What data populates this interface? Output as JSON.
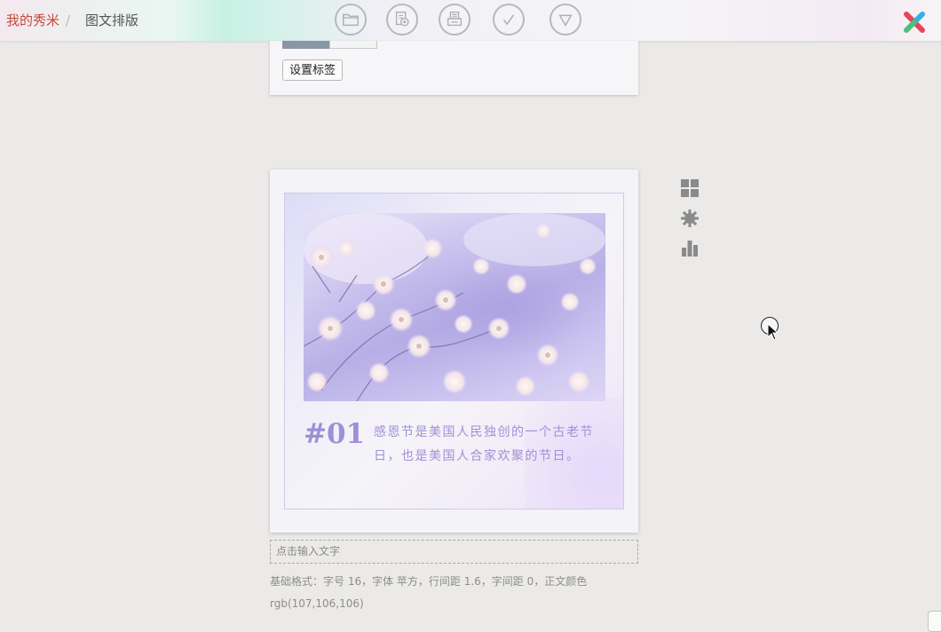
{
  "breadcrumb": {
    "home": "我的秀米",
    "separator": "/",
    "current": "图文排版"
  },
  "toolbar": {
    "buttons": [
      {
        "name": "folder-button",
        "icon": "folder-icon"
      },
      {
        "name": "preview-button",
        "icon": "preview-icon"
      },
      {
        "name": "print-button",
        "icon": "print-icon"
      },
      {
        "name": "check-button",
        "icon": "check-icon"
      },
      {
        "name": "dropdown-button",
        "icon": "triangle-down-icon"
      }
    ]
  },
  "top_panel": {
    "tag_button_label": "设置标签"
  },
  "card": {
    "number": "#01",
    "body": "感恩节是美国人民独创的一个古老节日，也是美国人合家欢聚的节日。"
  },
  "below_card": {
    "input_placeholder": "点击输入文字",
    "format_note": "基础格式：字号 16，字体 苹方，行间距 1.6，字间距 0，正文颜色 rgb(107,106,106)"
  },
  "side_icons": [
    "grid-icon",
    "gear-icon",
    "bar-chart-icon"
  ],
  "colors": {
    "brand_red": "#c8483f",
    "accent_purple": "#a38fd6",
    "number_purple": "#9f8fd7"
  }
}
